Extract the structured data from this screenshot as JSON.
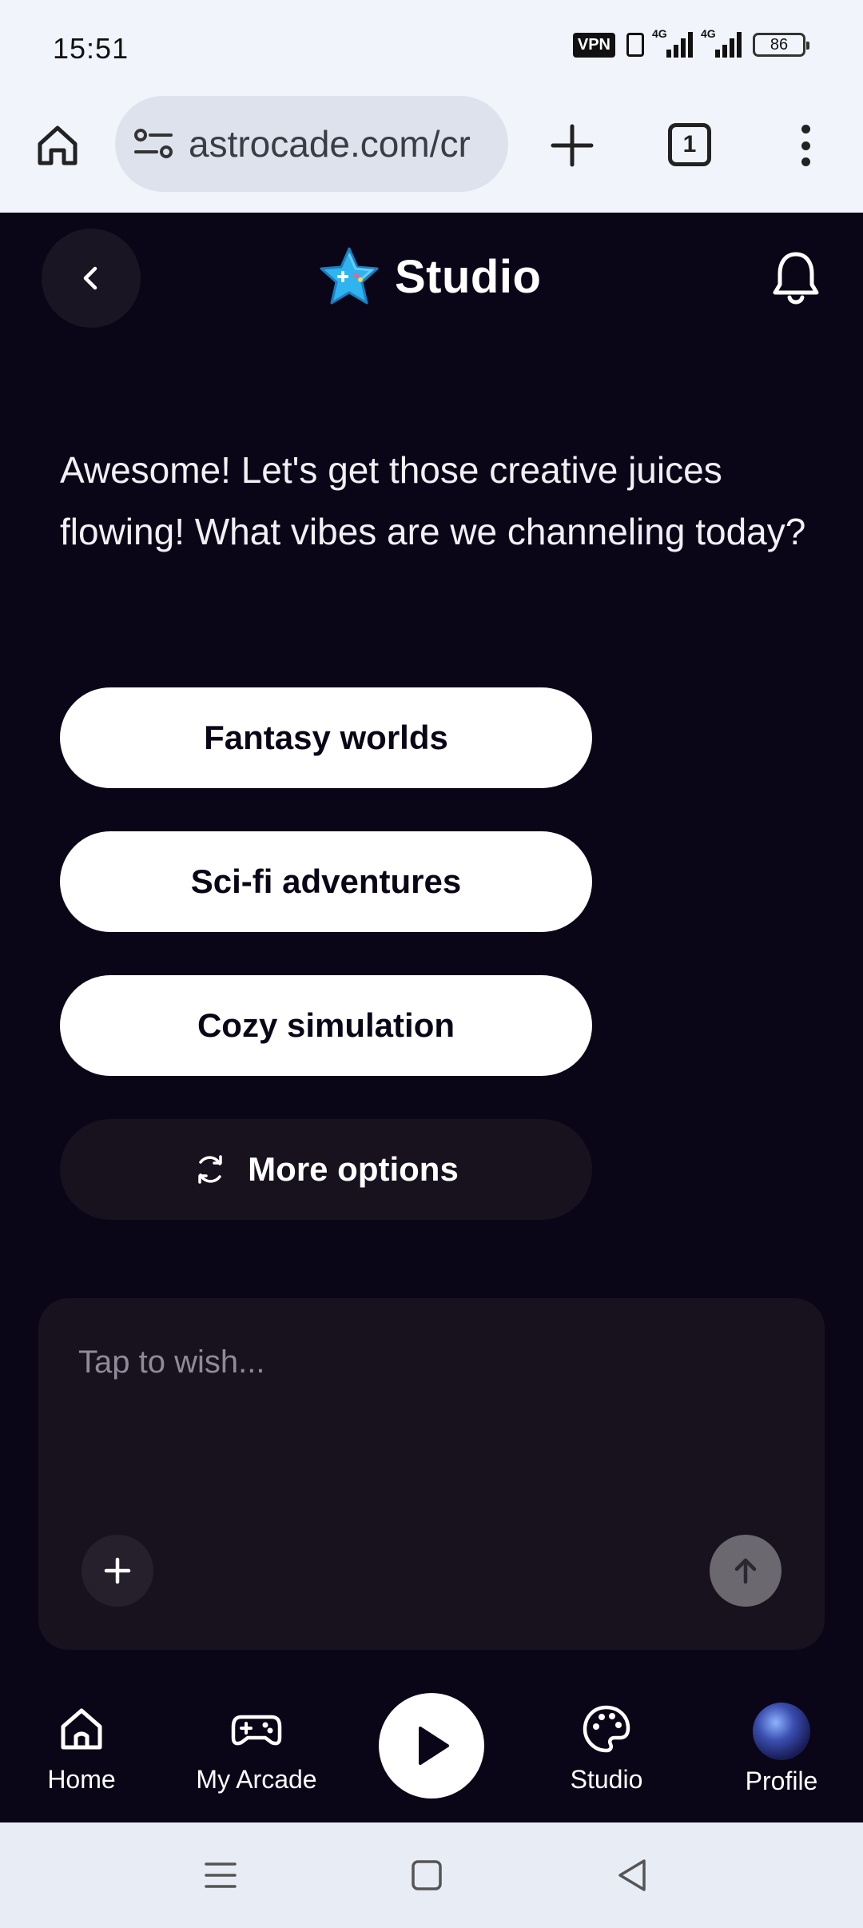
{
  "status_bar": {
    "time": "15:51",
    "vpn": "VPN",
    "network_1": "4G",
    "network_2": "4G",
    "battery": "86"
  },
  "browser": {
    "url": "astrocade.com/cr",
    "tab_count": "1"
  },
  "header": {
    "title": "Studio"
  },
  "chat": {
    "message": "Awesome! Let's get those creative juices flowing! What vibes are we channeling today?",
    "options": [
      "Fantasy worlds",
      "Sci-fi adventures",
      "Cozy simulation"
    ],
    "more_options": "More options"
  },
  "composer": {
    "placeholder": "Tap to wish..."
  },
  "nav": {
    "home": "Home",
    "my_arcade": "My Arcade",
    "studio": "Studio",
    "profile": "Profile"
  },
  "colors": {
    "background": "#0b0617",
    "surface": "#17121e",
    "accent_star": "#2fb4f0"
  }
}
